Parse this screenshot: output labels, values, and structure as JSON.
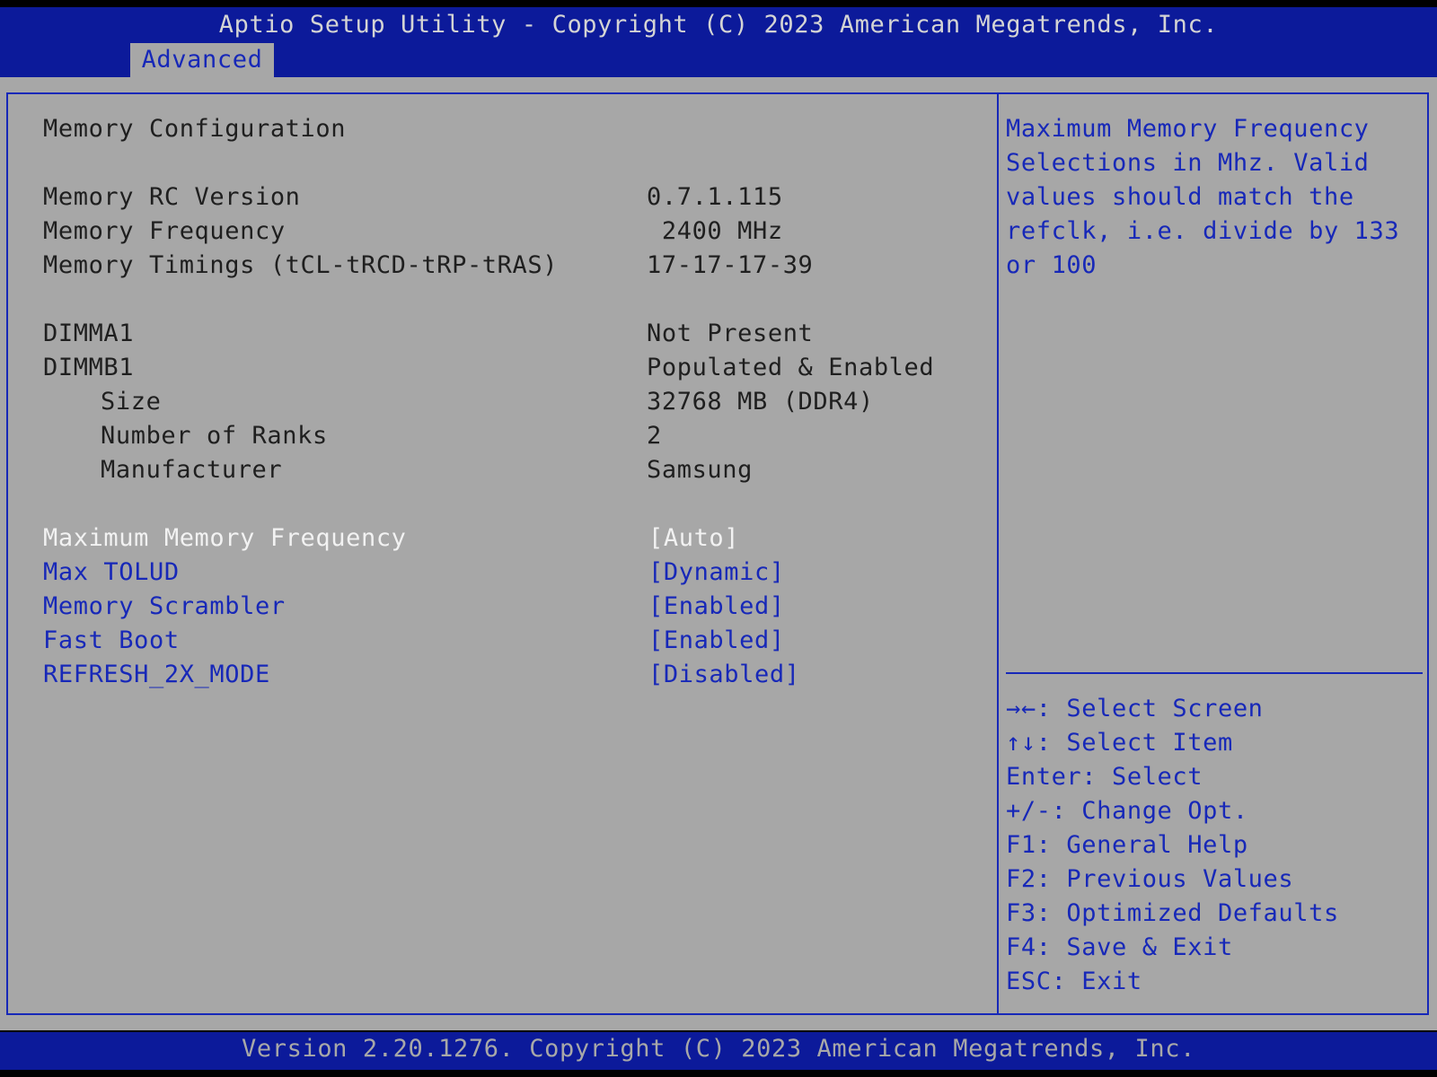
{
  "header": {
    "title": "Aptio Setup Utility - Copyright (C) 2023 American Megatrends, Inc.",
    "tab": "Advanced"
  },
  "main": {
    "section_title": "Memory Configuration",
    "info": [
      {
        "label": "Memory RC Version",
        "value": "0.7.1.115"
      },
      {
        "label": "Memory Frequency",
        "value": " 2400 MHz"
      },
      {
        "label": "Memory Timings (tCL-tRCD-tRP-tRAS)",
        "value": "17-17-17-39"
      },
      {
        "label": "DIMMA1",
        "value": "Not Present"
      },
      {
        "label": "DIMMB1",
        "value": "Populated & Enabled"
      },
      {
        "label": "Size",
        "value": "32768 MB (DDR4)"
      },
      {
        "label": "Number of Ranks",
        "value": "2"
      },
      {
        "label": "Manufacturer",
        "value": "Samsung"
      }
    ],
    "options": [
      {
        "label": "Maximum Memory Frequency",
        "value": "[Auto]"
      },
      {
        "label": "Max TOLUD",
        "value": "[Dynamic]"
      },
      {
        "label": "Memory Scrambler",
        "value": "[Enabled]"
      },
      {
        "label": "Fast Boot",
        "value": "[Enabled]"
      },
      {
        "label": "REFRESH_2X_MODE",
        "value": "[Disabled]"
      }
    ]
  },
  "help": {
    "lines": [
      "Maximum Memory Frequency",
      "Selections in Mhz. Valid",
      "values should match the",
      "refclk, i.e. divide by 133",
      "or 100"
    ]
  },
  "keys": [
    "→←: Select Screen",
    "↑↓: Select Item",
    "Enter: Select",
    "+/-: Change Opt.",
    "F1: General Help",
    "F2: Previous Values",
    "F3: Optimized Defaults",
    "F4: Save & Exit",
    "ESC: Exit"
  ],
  "footer": {
    "text": "Version 2.20.1276. Copyright (C) 2023 American Megatrends, Inc."
  },
  "colors": {
    "bar_blue": "#0c1a9a",
    "panel_gray": "#a7a7a7",
    "accent_blue": "#1728b8",
    "selected_text": "#f2f2f2"
  }
}
